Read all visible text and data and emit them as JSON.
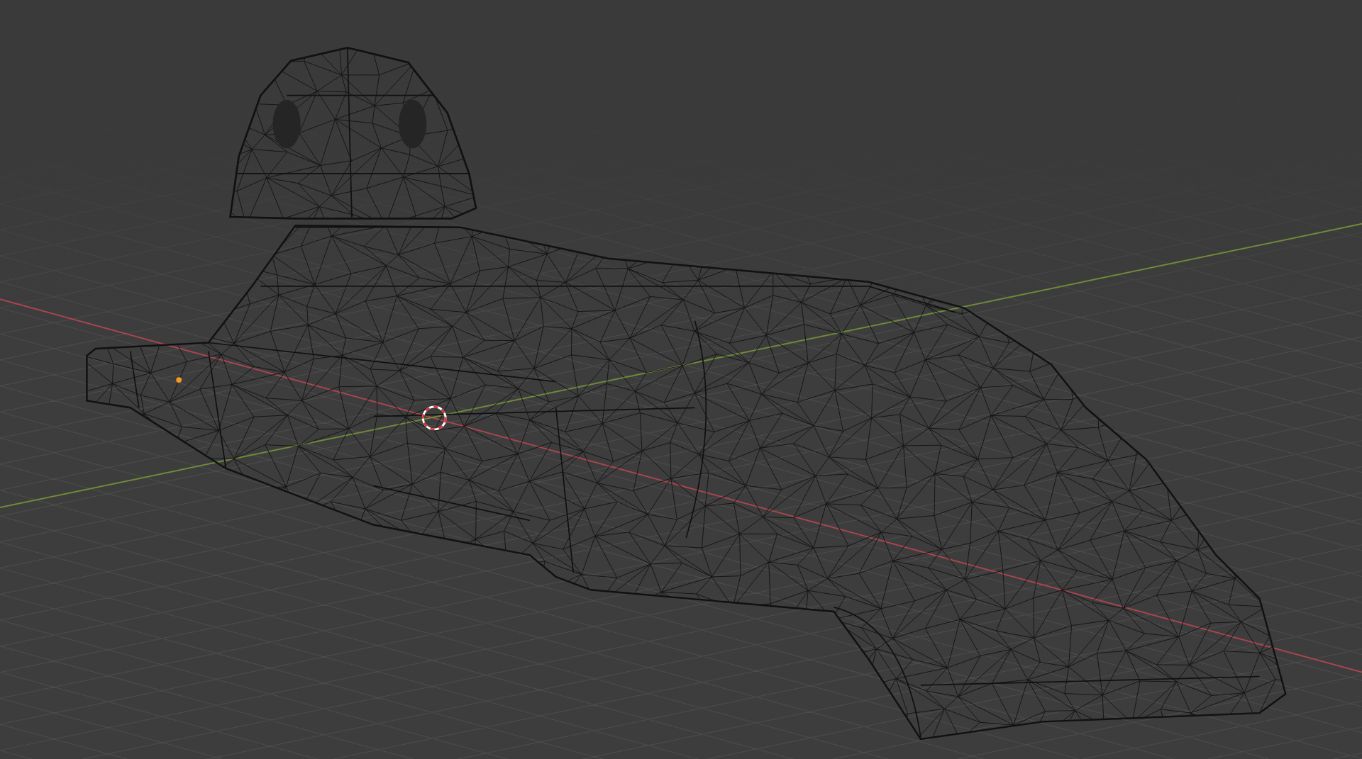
{
  "viewport": {
    "wireframe": true
  }
}
